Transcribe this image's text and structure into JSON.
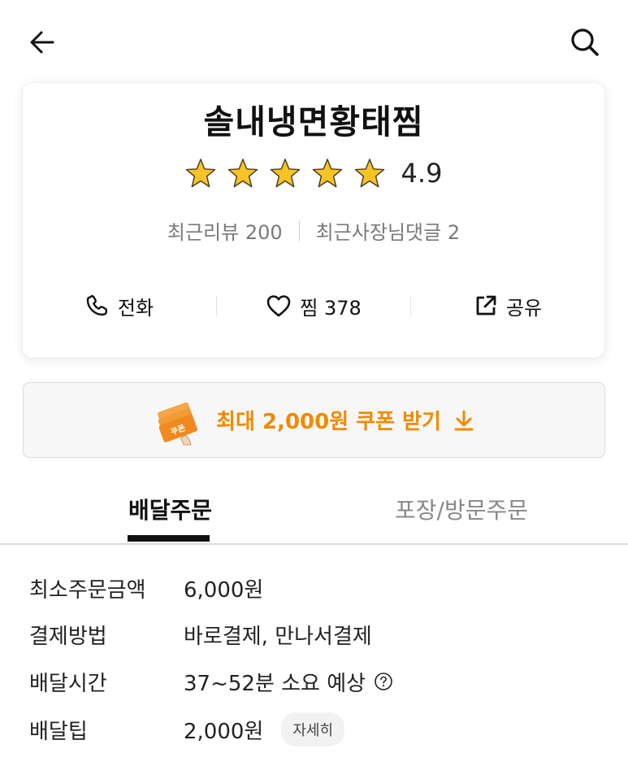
{
  "store": {
    "name": "솔내냉면황태찜",
    "rating": "4.9",
    "stars": 5,
    "recent_reviews": "최근리뷰 200",
    "owner_comments": "최근사장님댓글 2"
  },
  "actions": {
    "call": "전화",
    "like": "찜 378",
    "share": "공유"
  },
  "coupon": {
    "label": "최대 2,000원 쿠폰 받기"
  },
  "tabs": {
    "delivery": "배달주문",
    "pickup": "포장/방문주문"
  },
  "info": {
    "min_order_label": "최소주문금액",
    "min_order_value": "6,000원",
    "payment_label": "결제방법",
    "payment_value": "바로결제, 만나서결제",
    "time_label": "배달시간",
    "time_value": "37~52분 소요 예상",
    "tip_label": "배달팁",
    "tip_value": "2,000원",
    "tip_detail": "자세히"
  },
  "colors": {
    "accent": "#f08a00",
    "star": "#f7c325"
  }
}
